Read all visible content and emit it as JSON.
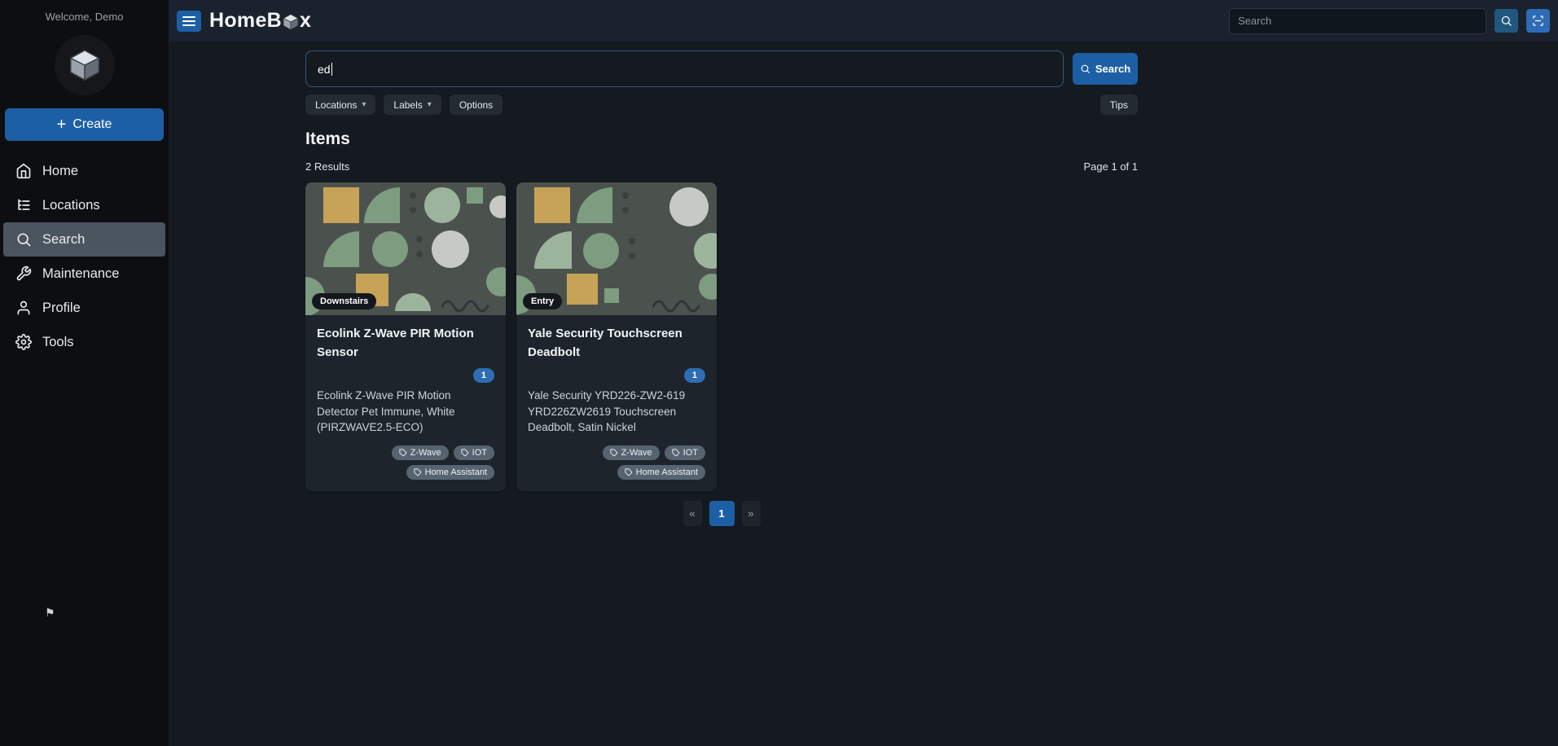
{
  "colors": {
    "accent": "#1d5fa5",
    "tag_bg": "#566470",
    "quantity_badge": "#2e6db3"
  },
  "topbar": {
    "brand_prefix": "HomeB",
    "brand_suffix": "x",
    "search_placeholder": "Search"
  },
  "sidebar": {
    "welcome": "Welcome, Demo",
    "create_label": "Create",
    "items": [
      {
        "label": "Home"
      },
      {
        "label": "Locations"
      },
      {
        "label": "Search"
      },
      {
        "label": "Maintenance"
      },
      {
        "label": "Profile"
      },
      {
        "label": "Tools"
      }
    ]
  },
  "search": {
    "value": "ed",
    "button_label": "Search",
    "filters": [
      {
        "label": "Locations"
      },
      {
        "label": "Labels"
      },
      {
        "label": "Options"
      }
    ],
    "tips_label": "Tips"
  },
  "results": {
    "heading": "Items",
    "count": "2 Results",
    "page": "Page 1 of 1"
  },
  "cards": [
    {
      "location": "Downstairs",
      "title": "Ecolink Z-Wave PIR Motion Sensor",
      "quantity": "1",
      "description": "Ecolink Z-Wave PIR Motion Detector Pet Immune, White (PIRZWAVE2.5-ECO)",
      "tags": [
        "Z-Wave",
        "IOT",
        "Home Assistant"
      ]
    },
    {
      "location": "Entry",
      "title": "Yale Security Touchscreen Deadbolt",
      "quantity": "1",
      "description": "Yale Security YRD226-ZW2-619 YRD226ZW2619 Touchscreen Deadbolt, Satin Nickel",
      "tags": [
        "Z-Wave",
        "IOT",
        "Home Assistant"
      ]
    }
  ],
  "pagination": {
    "prev": "«",
    "current": "1",
    "next": "»"
  }
}
